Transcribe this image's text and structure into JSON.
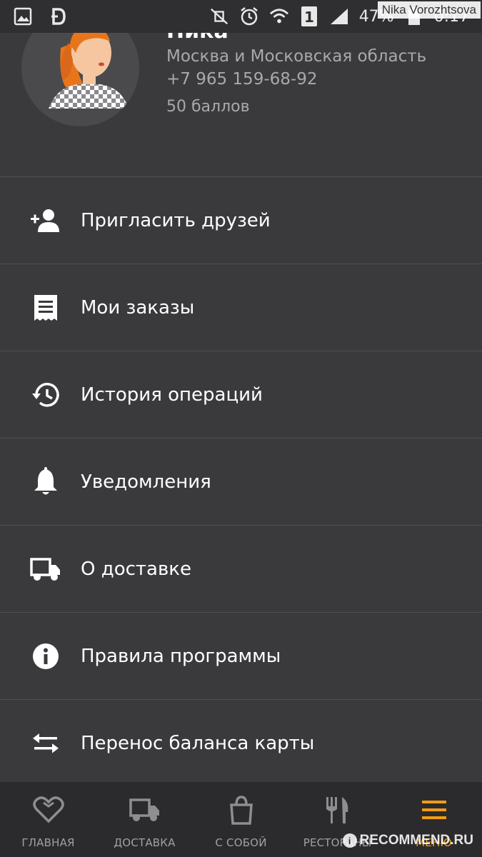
{
  "status_bar": {
    "battery_percent": "47%",
    "time": "0:17",
    "sim_slot": "1",
    "icons": [
      "gallery-icon",
      "d-app-icon",
      "mute-icon",
      "alarm-icon",
      "wifi-icon",
      "sim-icon",
      "signal-icon",
      "battery-icon"
    ]
  },
  "watermark_user": "Nika Vorozhtsova",
  "profile": {
    "name": "Ника",
    "region": "Москва и Московская область",
    "phone": "+7 965 159-68-92",
    "points": "50 баллов"
  },
  "menu": {
    "items": [
      {
        "label": "Пригласить друзей",
        "icon": "add-friend-icon"
      },
      {
        "label": "Мои заказы",
        "icon": "receipt-icon"
      },
      {
        "label": "История операций",
        "icon": "history-icon"
      },
      {
        "label": "Уведомления",
        "icon": "bell-icon"
      },
      {
        "label": "О доставке",
        "icon": "truck-icon"
      },
      {
        "label": "Правила программы",
        "icon": "info-icon"
      },
      {
        "label": "Перенос баланса карты",
        "icon": "transfer-icon"
      }
    ]
  },
  "bottom_nav": {
    "items": [
      {
        "label": "ГЛАВНАЯ",
        "icon": "heart-icon",
        "active": false
      },
      {
        "label": "ДОСТАВКА",
        "icon": "truck-icon",
        "active": false
      },
      {
        "label": "С СОБОЙ",
        "icon": "bag-icon",
        "active": false
      },
      {
        "label": "РЕСТОРАНЫ",
        "icon": "fork-knife-icon",
        "active": false
      },
      {
        "label": "МЕНЮ",
        "icon": "hamburger-menu-icon",
        "active": true
      }
    ]
  },
  "colors": {
    "background": "#3a3a3d",
    "accent": "#f39c12",
    "secondary_text": "#a9a9ad"
  },
  "watermark_site": "RECOMMEND.RU"
}
